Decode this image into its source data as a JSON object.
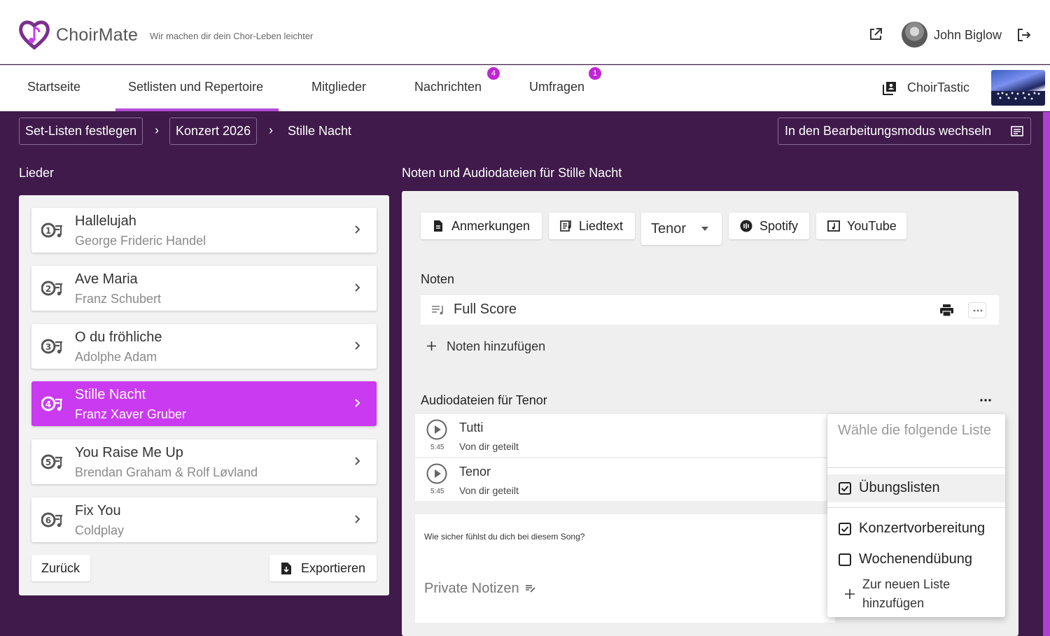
{
  "app": {
    "name": "ChoirMate",
    "tagline": "Wir machen dir dein Chor-Leben leichter",
    "brand_color": "#c93af0",
    "background_color": "#3f1a4a"
  },
  "user": {
    "name": "John Biglow"
  },
  "nav": {
    "tabs": [
      {
        "label": "Startseite"
      },
      {
        "label": "Setlisten und Repertoire",
        "active": true
      },
      {
        "label": "Mitglieder"
      },
      {
        "label": "Nachrichten",
        "badge": "4"
      },
      {
        "label": "Umfragen",
        "badge": "1"
      }
    ],
    "choir_name": "ChoirTastic"
  },
  "breadcrumb": {
    "items": [
      "Set-Listen festlegen",
      "Konzert 2026"
    ],
    "current": "Stille Nacht",
    "edit_mode_label": "In den Bearbeitungsmodus wechseln"
  },
  "songs": {
    "title": "Lieder",
    "items": [
      {
        "number": "1",
        "title": "Hallelujah",
        "artist": "George Frideric Handel"
      },
      {
        "number": "2",
        "title": "Ave Maria",
        "artist": "Franz Schubert"
      },
      {
        "number": "3",
        "title": "O du fröhliche",
        "artist": "Adolphe Adam"
      },
      {
        "number": "4",
        "title": "Stille Nacht",
        "artist": "Franz Xaver Gruber",
        "active": true
      },
      {
        "number": "5",
        "title": "You Raise Me Up",
        "artist": "Brendan Graham & Rolf Løvland"
      },
      {
        "number": "6",
        "title": "Fix You",
        "artist": "Coldplay"
      }
    ],
    "back_label": "Zurück",
    "export_label": "Exportieren"
  },
  "detail": {
    "title": "Noten und Audiodateien für Stille Nacht",
    "toolbar": {
      "notes_label": "Anmerkungen",
      "lyrics_label": "Liedtext",
      "voice_value": "Tenor",
      "spotify_label": "Spotify",
      "youtube_label": "YouTube"
    },
    "scores_title": "Noten",
    "scores": [
      {
        "name": "Full Score"
      }
    ],
    "add_scores_label": "Noten hinzufügen",
    "audio_title": "Audiodateien für Tenor",
    "audio": [
      {
        "name": "Tutti",
        "shared": "Von dir geteilt",
        "duration": "5:45"
      },
      {
        "name": "Tenor",
        "shared": "Von dir geteilt",
        "duration": "5:45"
      }
    ],
    "confidence_question": "Wie sicher fühlst du dich bei diesem Song?",
    "private_notes_placeholder": "Private Notizen"
  },
  "dropdown": {
    "header": "Wähle die folgende Liste",
    "items": [
      {
        "label": "Übungslisten",
        "checked": true
      },
      {
        "label": "Konzertvorbereitung",
        "checked": true
      },
      {
        "label": "Wochenendübung",
        "checked": false
      }
    ],
    "add_label": "Zur neuen Liste hinzufügen"
  }
}
